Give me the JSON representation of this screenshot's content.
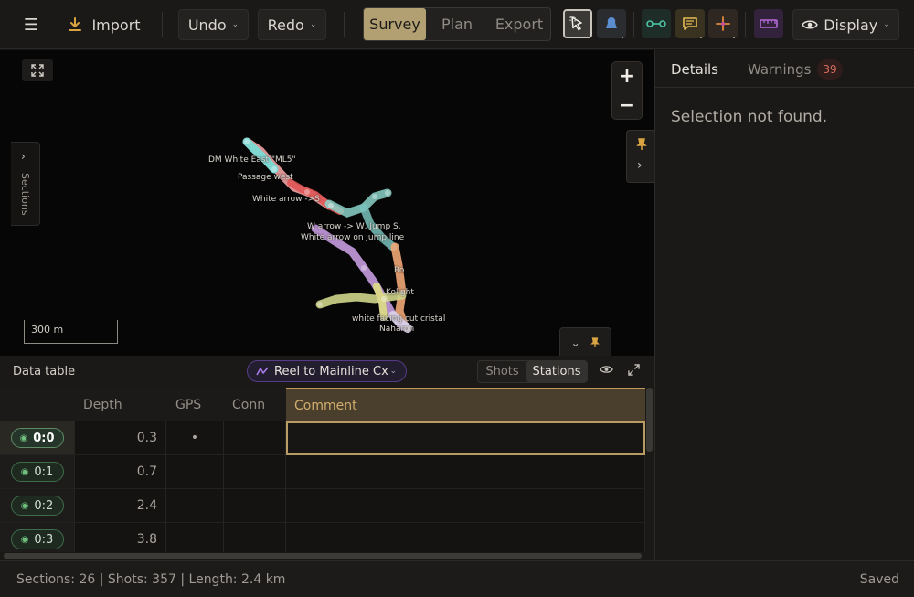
{
  "toolbar": {
    "menu_icon": "☰",
    "import_label": "Import",
    "undo_label": "Undo",
    "redo_label": "Redo",
    "modes": [
      "Survey",
      "Plan",
      "Export"
    ],
    "active_mode": "Survey",
    "display_label": "Display",
    "icons": [
      "menu-icon",
      "import-icon",
      "select-tool-icon",
      "station-tool-icon",
      "shot-link-icon",
      "comment-tool-icon",
      "spark-tool-icon",
      "ruler-icon",
      "eye-icon"
    ],
    "colors": {
      "accent": "#b29f72",
      "link_tool": "#3d8b72",
      "comment_tool": "#d8b14a",
      "spark_tool": "#e08a3c",
      "ruler_tool": "#a860c9"
    }
  },
  "map": {
    "sections_label": "Sections",
    "zoom_in": "+",
    "zoom_out": "−",
    "scale_label": "300 m",
    "labels": [
      "DM White East \"ML5\"",
      "Passage west",
      "White arrow ->S",
      "W arrow -> W, Jump S,",
      "White arrow on jump line",
      "Ro",
      "Kolight",
      "white facing cut cristal",
      "Naharon"
    ]
  },
  "details": {
    "tab_details": "Details",
    "tab_warnings": "Warnings",
    "warnings_count": "39",
    "empty_message": "Selection not found."
  },
  "data_table": {
    "title": "Data table",
    "section": "Reel to Mainline Cx",
    "toggle": [
      "Shots",
      "Stations"
    ],
    "active_toggle": "Stations",
    "columns": {
      "depth": "Depth",
      "gps": "GPS",
      "conn": "Conn",
      "comment": "Comment"
    },
    "rows": [
      {
        "station": "0:0",
        "depth": "0.3",
        "gps": "•",
        "conn": "",
        "comment": ""
      },
      {
        "station": "0:1",
        "depth": "0.7",
        "gps": "",
        "conn": "",
        "comment": ""
      },
      {
        "station": "0:2",
        "depth": "2.4",
        "gps": "",
        "conn": "",
        "comment": ""
      },
      {
        "station": "0:3",
        "depth": "3.8",
        "gps": "",
        "conn": "",
        "comment": ""
      }
    ]
  },
  "status": {
    "summary": "Sections: 26 | Shots: 357 | Length: 2.4 km",
    "saved": "Saved"
  }
}
